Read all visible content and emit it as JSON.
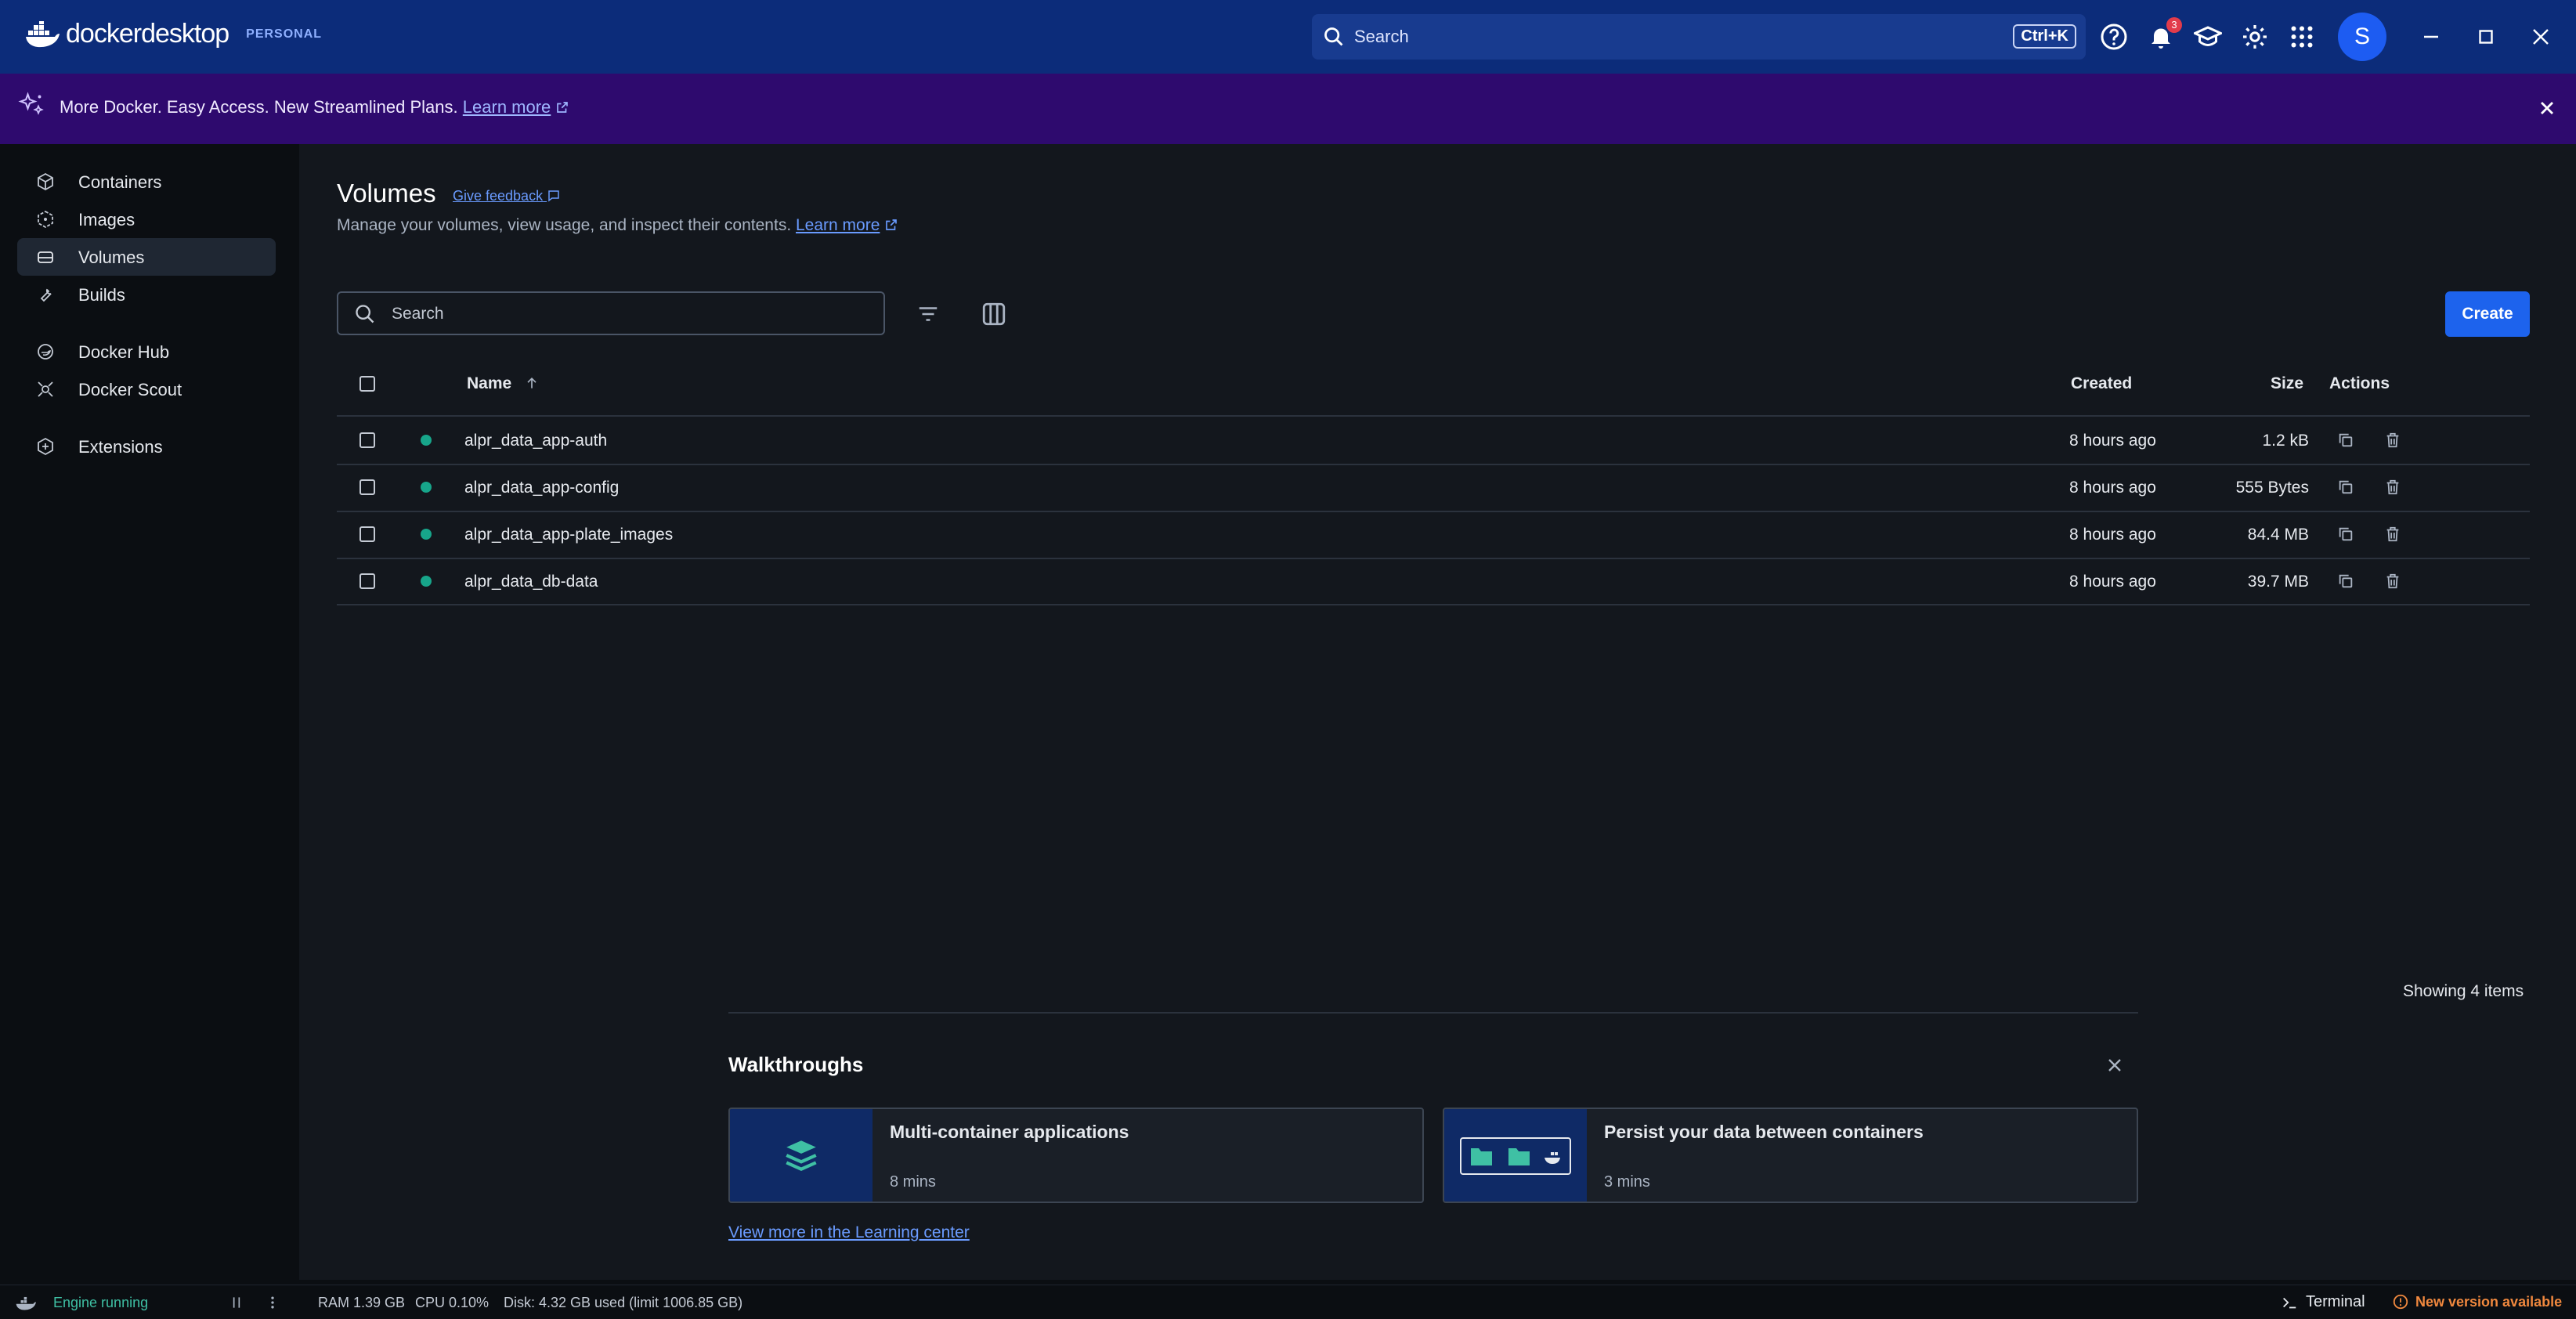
{
  "app": {
    "logo_main": "docker",
    "logo_sub": "desktop",
    "plan": "PERSONAL"
  },
  "titlebar": {
    "search_label": "Search",
    "shortcut": "Ctrl+K",
    "notification_count": "3",
    "avatar_letter": "S"
  },
  "banner": {
    "text": "More Docker. Easy Access. New Streamlined Plans.",
    "link": "Learn more"
  },
  "sidebar": {
    "items": [
      {
        "label": "Containers",
        "icon": "containers-icon"
      },
      {
        "label": "Images",
        "icon": "images-icon"
      },
      {
        "label": "Volumes",
        "icon": "volumes-icon",
        "active": true
      },
      {
        "label": "Builds",
        "icon": "builds-icon"
      },
      {
        "label": "Docker Hub",
        "icon": "docker-hub-icon"
      },
      {
        "label": "Docker Scout",
        "icon": "docker-scout-icon"
      },
      {
        "label": "Extensions",
        "icon": "extensions-icon"
      }
    ]
  },
  "page": {
    "title": "Volumes",
    "feedback": "Give feedback",
    "subtitle": "Manage your volumes, view usage, and inspect their contents.",
    "subtitle_link": "Learn more",
    "search_placeholder": "Search",
    "create_label": "Create"
  },
  "table": {
    "headers": {
      "name": "Name",
      "created": "Created",
      "size": "Size",
      "actions": "Actions"
    },
    "rows": [
      {
        "name": "alpr_data_app-auth",
        "created": "8 hours ago",
        "size": "1.2 kB",
        "status": "in-use"
      },
      {
        "name": "alpr_data_app-config",
        "created": "8 hours ago",
        "size": "555 Bytes",
        "status": "in-use"
      },
      {
        "name": "alpr_data_app-plate_images",
        "created": "8 hours ago",
        "size": "84.4 MB",
        "status": "in-use"
      },
      {
        "name": "alpr_data_db-data",
        "created": "8 hours ago",
        "size": "39.7 MB",
        "status": "in-use"
      }
    ],
    "showing": "Showing 4 items"
  },
  "walkthroughs": {
    "title": "Walkthroughs",
    "cards": [
      {
        "title": "Multi-container applications",
        "duration": "8 mins"
      },
      {
        "title": "Persist your data between containers",
        "duration": "3 mins"
      }
    ],
    "learning_link": "View more in the Learning center"
  },
  "statusbar": {
    "engine": "Engine running",
    "ram": "RAM 1.39 GB",
    "cpu": "CPU 0.10%",
    "disk": "Disk: 4.32 GB used (limit 1006.85 GB)",
    "terminal": "Terminal",
    "update": "New version available"
  },
  "colors": {
    "accent": "#1d63ed",
    "titlebar": "#0c2c7a",
    "banner": "#2e0a6e",
    "status_green": "#17a58a",
    "warning": "#f0883e"
  }
}
